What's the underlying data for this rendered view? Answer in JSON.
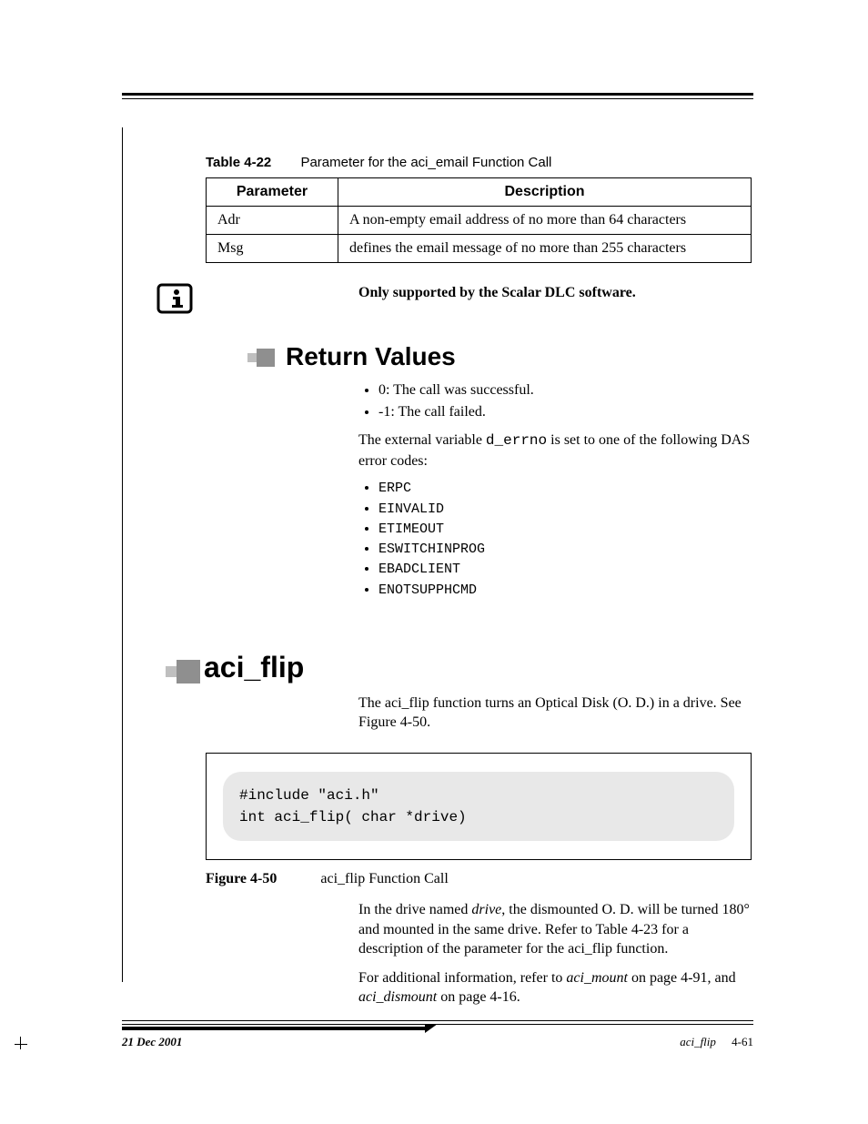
{
  "table": {
    "caption_label": "Table 4-22",
    "caption_text": "Parameter for the aci_email Function Call",
    "headers": {
      "c0": "Parameter",
      "c1": "Description"
    },
    "rows": [
      {
        "c0": "Adr",
        "c1": "A non-empty email address of no more than 64 characters"
      },
      {
        "c0": "Msg",
        "c1": "defines the email message of no more than 255 characters"
      }
    ]
  },
  "info_note": "Only supported by the Scalar DLC software.",
  "return_values": {
    "heading": "Return Values",
    "bullets": [
      "0: The call was successful.",
      "-1: The call failed."
    ],
    "errno_sentence_pre": "The external variable ",
    "errno_var": "d_errno",
    "errno_sentence_post": " is set to one of the following DAS error codes:",
    "codes": [
      "ERPC",
      "EINVALID",
      "ETIMEOUT",
      "ESWITCHINPROG",
      "EBADCLIENT",
      "ENOTSUPPHCMD"
    ]
  },
  "aci_flip": {
    "heading": "aci_flip",
    "intro": "The aci_flip function turns an Optical Disk (O. D.) in a drive. See Figure 4-50.",
    "code": "#include \"aci.h\"\nint aci_flip( char *drive)",
    "fig_label": "Figure 4-50",
    "fig_text": "aci_flip Function Call",
    "p1_pre": "In the drive named ",
    "p1_drive": "drive",
    "p1_post": ", the dismounted O. D. will be turned 180° and mounted in the same drive. Refer to Table 4-23   for a description of the parameter for the aci_flip function.",
    "p2_pre": "For additional information, refer to ",
    "p2_ref1": "aci_mount",
    "p2_mid": "  on page 4-91, and ",
    "p2_ref2": "aci_dismount",
    "p2_post": "  on page 4-16."
  },
  "footer": {
    "date": "21 Dec 2001",
    "section": "aci_flip",
    "page": "4-61"
  }
}
